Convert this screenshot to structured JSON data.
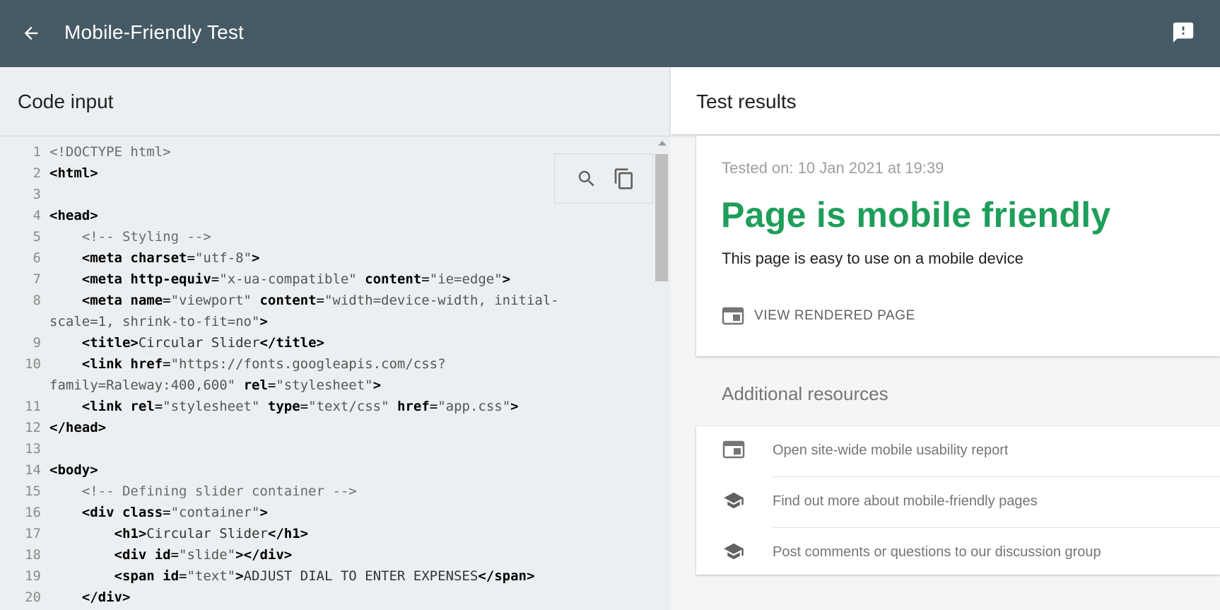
{
  "header": {
    "title": "Mobile-Friendly Test",
    "back_icon": "arrow-back-icon",
    "feedback_icon": "feedback-icon"
  },
  "code_panel": {
    "title": "Code input",
    "tools": {
      "search_icon": "search-icon",
      "copy_icon": "copy-icon"
    },
    "lines": [
      {
        "n": "1",
        "html": "<span class=\"c\">&lt;!DOCTYPE html&gt;</span>"
      },
      {
        "n": "2",
        "html": "<b>&lt;html&gt;</b>"
      },
      {
        "n": "3",
        "html": ""
      },
      {
        "n": "4",
        "html": "<b>&lt;head&gt;</b>"
      },
      {
        "n": "5",
        "html": "    <span class=\"c\">&lt;!-- Styling --&gt;</span>"
      },
      {
        "n": "6",
        "html": "    <b>&lt;meta charset</b>=<span class=\"s\">\"utf-8\"</span><b>&gt;</b>"
      },
      {
        "n": "7",
        "html": "    <b>&lt;meta http-equiv</b>=<span class=\"s\">\"x-ua-compatible\"</span> <b>content</b>=<span class=\"s\">\"ie=edge\"</span><b>&gt;</b>"
      },
      {
        "n": "8",
        "html": "    <b>&lt;meta name</b>=<span class=\"s\">\"viewport\"</span> <b>content</b>=<span class=\"s\">\"width=device-width, initial-</span>"
      },
      {
        "n": "",
        "html": "<span class=\"s\">scale=1, shrink-to-fit=no\"</span><b>&gt;</b>"
      },
      {
        "n": "9",
        "html": "    <b>&lt;title&gt;</b><span class=\"t\">Circular Slider</span><b>&lt;/title&gt;</b>"
      },
      {
        "n": "10",
        "html": "    <b>&lt;link href</b>=<span class=\"s\">\"https://fonts.googleapis.com/css?</span>"
      },
      {
        "n": "",
        "html": "<span class=\"s\">family=Raleway:400,600\"</span> <b>rel</b>=<span class=\"s\">\"stylesheet\"</span><b>&gt;</b>"
      },
      {
        "n": "11",
        "html": "    <b>&lt;link rel</b>=<span class=\"s\">\"stylesheet\"</span> <b>type</b>=<span class=\"s\">\"text/css\"</span> <b>href</b>=<span class=\"s\">\"app.css\"</span><b>&gt;</b>"
      },
      {
        "n": "12",
        "html": "<b>&lt;/head&gt;</b>"
      },
      {
        "n": "13",
        "html": ""
      },
      {
        "n": "14",
        "html": "<b>&lt;body&gt;</b>"
      },
      {
        "n": "15",
        "html": "    <span class=\"c\">&lt;!-- Defining slider container --&gt;</span>"
      },
      {
        "n": "16",
        "html": "    <b>&lt;div class</b>=<span class=\"s\">\"container\"</span><b>&gt;</b>"
      },
      {
        "n": "17",
        "html": "        <b>&lt;h1&gt;</b><span class=\"t\">Circular Slider</span><b>&lt;/h1&gt;</b>"
      },
      {
        "n": "18",
        "html": "        <b>&lt;div id</b>=<span class=\"s\">\"slide\"</span><b>&gt;&lt;/div&gt;</b>"
      },
      {
        "n": "19",
        "html": "        <b>&lt;span id</b>=<span class=\"s\">\"text\"</span><b>&gt;</b><span class=\"t\">ADJUST DIAL TO ENTER EXPENSES</span><b>&lt;/span&gt;</b>"
      },
      {
        "n": "20",
        "html": "    <b>&lt;/div&gt;</b>"
      }
    ]
  },
  "results": {
    "title": "Test results",
    "tested_on": "Tested on: 10 Jan 2021 at 19:39",
    "verdict": "Page is mobile friendly",
    "verdict_color": "#1e9e5a",
    "description": "This page is easy to use on a mobile device",
    "view_rendered_label": "VIEW RENDERED PAGE",
    "view_rendered_icon": "rendered-page-icon"
  },
  "additional": {
    "title": "Additional resources",
    "items": [
      {
        "label": "Open site-wide mobile usability report",
        "icon": "report-icon"
      },
      {
        "label": "Find out more about mobile-friendly pages",
        "icon": "school-icon"
      },
      {
        "label": "Post comments or questions to our discussion group",
        "icon": "school-icon"
      }
    ]
  }
}
